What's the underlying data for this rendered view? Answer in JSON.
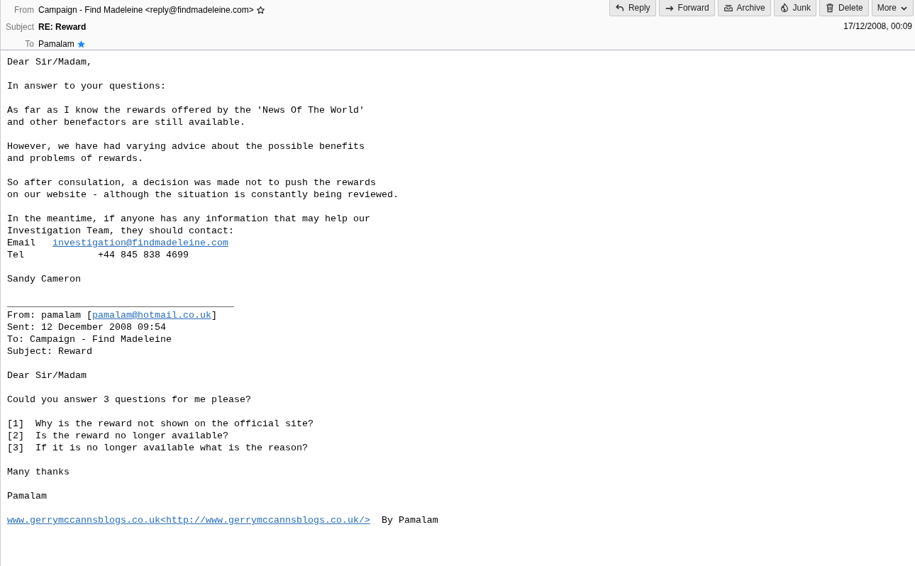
{
  "header": {
    "fields": [
      {
        "kind": "from",
        "label": "From",
        "value": "Campaign - Find Madeleine <reply@findmadeleine.com>",
        "starred": false
      },
      {
        "kind": "subject",
        "label": "Subject",
        "value": "RE: Reward"
      },
      {
        "kind": "to",
        "label": "To",
        "value": "Pamalam",
        "starred": true
      }
    ],
    "date": "17/12/2008, 00:09",
    "buttons": [
      {
        "kind": "reply",
        "label": "Reply"
      },
      {
        "kind": "forward",
        "label": "Forward"
      },
      {
        "kind": "archive",
        "label": "Archive"
      },
      {
        "kind": "junk",
        "label": "Junk"
      },
      {
        "kind": "delete",
        "label": "Delete"
      },
      {
        "kind": "more",
        "label": "More"
      }
    ]
  },
  "body": [
    [
      "Dear Sir/Madam,"
    ],
    [
      "In answer to your questions:"
    ],
    [
      "As far as I know the rewards offered by the 'News Of The World'",
      "and other benefactors are still available."
    ],
    [
      "However, we have had varying advice about the possible benefits",
      "and problems of rewards."
    ],
    [
      "So after consulation, a decision was made not to push the rewards",
      "on our website - although the situation is constantly being reviewed."
    ],
    [
      "In the meantime, if anyone has any information that may help our",
      "Investigation Team, they should contact:",
      [
        {
          "kind": "text",
          "text": "Email   "
        },
        {
          "kind": "link",
          "text": "investigation@findmadeleine.com"
        }
      ],
      "Tel             +44 845 838 4699"
    ],
    [
      "Sandy Cameron"
    ],
    [
      "________________________________________",
      [
        {
          "kind": "text",
          "text": "From: pamalam ["
        },
        {
          "kind": "link",
          "text": "pamalam@hotmail.co.uk"
        },
        {
          "kind": "text",
          "text": "]"
        }
      ],
      "Sent: 12 December 2008 09:54",
      "To: Campaign - Find Madeleine",
      "Subject: Reward"
    ],
    [
      "Dear Sir/Madam"
    ],
    [
      "Could you answer 3 questions for me please?"
    ],
    [
      "[1]  Why is the reward not shown on the official site?",
      "[2]  Is the reward no longer available?",
      "[3]  If it is no longer available what is the reason?"
    ],
    [
      "Many thanks"
    ],
    [
      "Pamalam"
    ],
    [
      [
        {
          "kind": "link",
          "text": "www.gerrymccannsblogs.co.uk<http://www.gerrymccannsblogs.co.uk/>"
        },
        {
          "kind": "text",
          "text": "  By Pamalam"
        }
      ]
    ]
  ]
}
